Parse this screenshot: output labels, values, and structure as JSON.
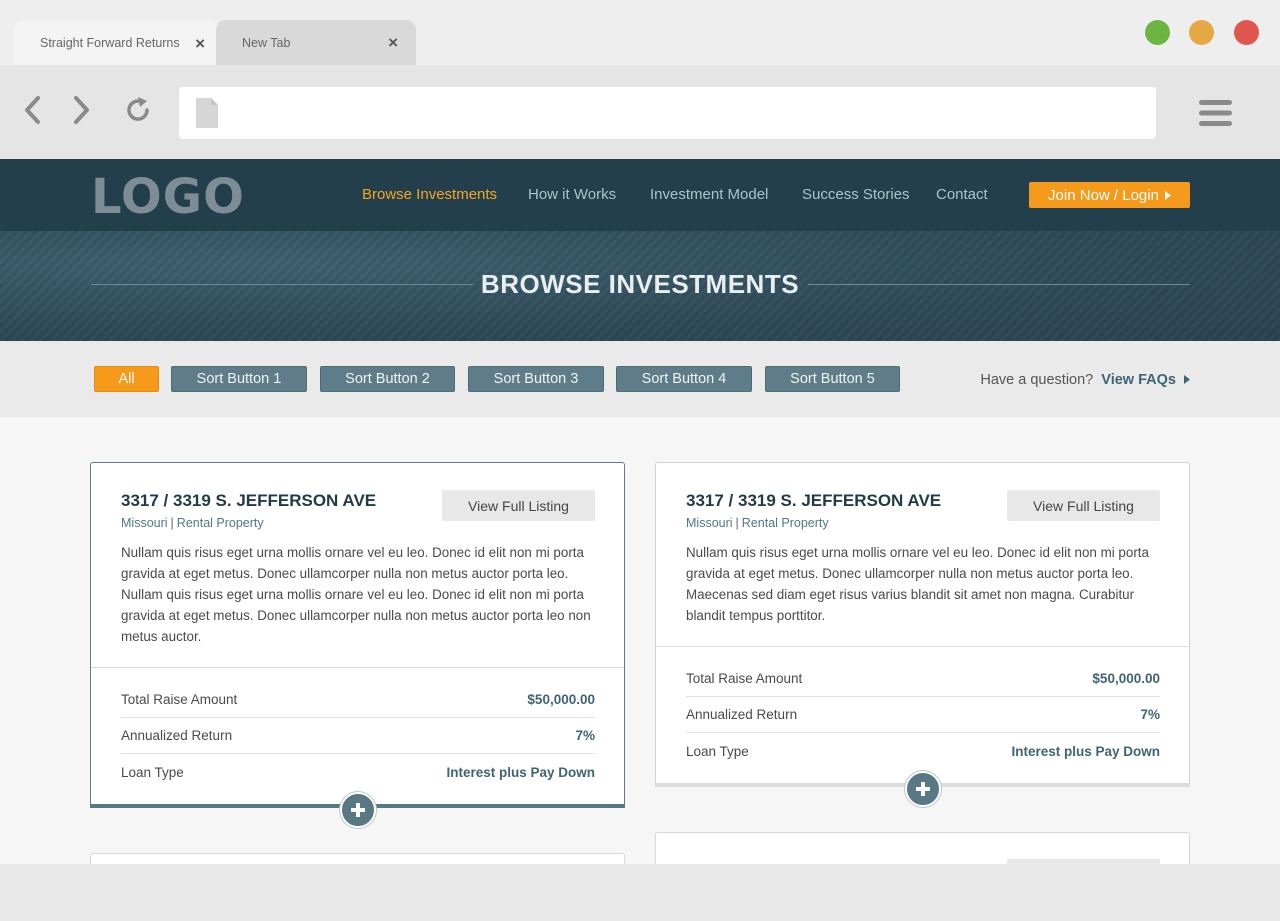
{
  "browser": {
    "tabs": [
      {
        "label": "Straight Forward Returns",
        "close": "×"
      },
      {
        "label": "New Tab",
        "close": "×"
      }
    ],
    "window_controls": {
      "green": "#6cb543",
      "yellow": "#e6a844",
      "red": "#e0574f"
    },
    "nav_icons": [
      "back-arrow-icon",
      "forward-arrow-icon",
      "reload-icon"
    ],
    "url": "",
    "menu_icon": "hamburger-menu-icon"
  },
  "site": {
    "logo": "LOGO",
    "nav": [
      {
        "label": "Browse Investments",
        "active": true
      },
      {
        "label": "How it Works",
        "active": false
      },
      {
        "label": "Investment Model",
        "active": false
      },
      {
        "label": "Success Stories",
        "active": false
      },
      {
        "label": "Contact",
        "active": false
      }
    ],
    "cta": "Join Now / Login",
    "hero_title": "BROWSE INVESTMENTS"
  },
  "filters": {
    "buttons": [
      "All",
      "Sort Button 1",
      "Sort Button 2",
      "Sort Button 3",
      "Sort Button 4",
      "Sort Button 5"
    ],
    "active": "All",
    "question": "Have a question?",
    "faq_link": "View FAQs"
  },
  "listings": [
    {
      "title": "3317 / 3319 S. JEFFERSON AVE",
      "state": "Missouri",
      "separator": "|",
      "type": "Rental Property",
      "button": "View Full Listing",
      "description": "Nullam quis risus eget urna mollis ornare vel eu leo. Donec id elit non mi porta gravida at eget metus. Donec ullamcorper nulla non metus auctor porta leo. Nullam quis risus eget urna mollis ornare vel eu leo. Donec id elit non mi porta gravida at eget metus. Donec ullamcorper nulla non metus auctor porta leo non metus auctor.",
      "stats": [
        {
          "label": "Total Raise Amount",
          "value": "$50,000.00"
        },
        {
          "label": "Annualized Return",
          "value": "7%"
        },
        {
          "label": "Loan Type",
          "value": "Interest plus Pay Down"
        }
      ]
    },
    {
      "title": "3317 / 3319 S. JEFFERSON AVE",
      "state": "Missouri",
      "separator": "|",
      "type": "Rental Property",
      "button": "View Full Listing",
      "description": "Nullam quis risus eget urna mollis ornare vel eu leo. Donec id elit non mi porta gravida at eget metus. Donec ullamcorper nulla non metus auctor porta leo. Maecenas sed diam eget risus varius blandit sit amet non magna. Curabitur blandit tempus porttitor.",
      "stats": [
        {
          "label": "Total Raise Amount",
          "value": "$50,000.00"
        },
        {
          "label": "Annualized Return",
          "value": "7%"
        },
        {
          "label": "Loan Type",
          "value": "Interest plus Pay Down"
        }
      ]
    }
  ],
  "colors": {
    "accent_orange": "#f59a1b",
    "nav_dark": "#243f4c",
    "slate": "#5f7d89",
    "link_blue": "#3f6473"
  }
}
